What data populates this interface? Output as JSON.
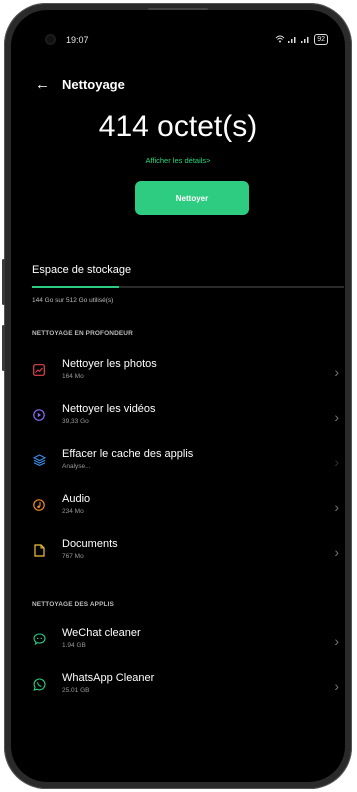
{
  "status": {
    "time": "19:07",
    "battery": "92"
  },
  "header": {
    "title": "Nettoyage"
  },
  "summary": {
    "size": "414 octet(s)",
    "details_link": "Afficher les détails>",
    "clean_button": "Nettoyer"
  },
  "storage": {
    "title": "Espace de stockage",
    "usage_text": "144 Go sur 512 Go utilisé(s)",
    "used_fraction": 0.28
  },
  "deep_section": {
    "title": "NETTOYAGE EN PROFONDEUR",
    "items": [
      {
        "label": "Nettoyer les photos",
        "sub": "164 Mo",
        "icon": "photo-icon",
        "color": "#e0454d"
      },
      {
        "label": "Nettoyer les vidéos",
        "sub": "39,33 Go",
        "icon": "video-icon",
        "color": "#8b6cf0"
      },
      {
        "label": "Effacer le cache des applis",
        "sub": "Analyse...",
        "icon": "layers-icon",
        "color": "#3b8ff0"
      },
      {
        "label": "Audio",
        "sub": "234 Mo",
        "icon": "music-icon",
        "color": "#f08a2e"
      },
      {
        "label": "Documents",
        "sub": "767 Mo",
        "icon": "document-icon",
        "color": "#f2c43c"
      }
    ]
  },
  "apps_section": {
    "title": "NETTOYAGE DES APPLIS",
    "items": [
      {
        "label": "WeChat cleaner",
        "sub": "1.94 GB",
        "icon": "wechat-icon",
        "color": "#2ecc80"
      },
      {
        "label": "WhatsApp Cleaner",
        "sub": "25.01 GB",
        "icon": "whatsapp-icon",
        "color": "#2ecc80"
      }
    ]
  }
}
